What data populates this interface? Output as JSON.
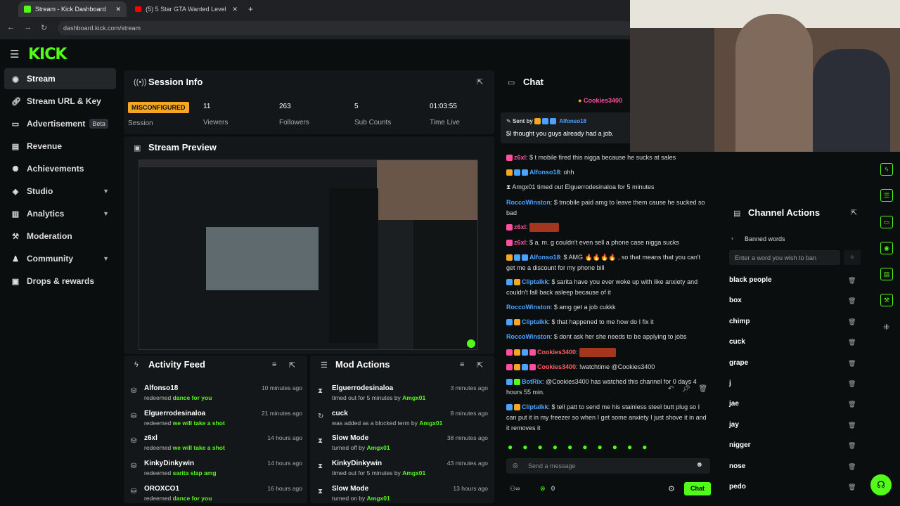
{
  "browser": {
    "tabs": [
      {
        "label": "Stream - Kick Dashboard"
      },
      {
        "label": "(5) 5 Star GTA Wanted Level in I"
      }
    ],
    "address": "dashboard.kick.com/stream"
  },
  "brand": {
    "logo": "KICK",
    "accent": "#53fc18"
  },
  "sidebar": {
    "items": [
      {
        "label": "Stream"
      },
      {
        "label": "Stream URL & Key"
      },
      {
        "label": "Advertisement",
        "badge": "Beta"
      },
      {
        "label": "Revenue"
      },
      {
        "label": "Achievements"
      },
      {
        "label": "Studio"
      },
      {
        "label": "Analytics"
      },
      {
        "label": "Moderation"
      },
      {
        "label": "Community"
      },
      {
        "label": "Drops & rewards"
      }
    ]
  },
  "session": {
    "title": "Session Info",
    "status": "MISCONFIGURED",
    "status_label": "Session",
    "viewers": "11",
    "viewers_label": "Viewers",
    "followers": "263",
    "followers_label": "Followers",
    "subs": "5",
    "subs_label": "Sub Counts",
    "time": "01:03:55",
    "time_label": "Time Live"
  },
  "preview": {
    "title": "Stream Preview"
  },
  "activity": {
    "title": "Activity Feed",
    "rows": [
      {
        "name": "Alfonso18",
        "prefix": "redeemed",
        "reward": "dance for you",
        "ago": "10 minutes ago"
      },
      {
        "name": "Elguerrodesinaloa",
        "prefix": "redeemed",
        "reward": "we will take a shot",
        "ago": "21 minutes ago"
      },
      {
        "name": "z6xl",
        "prefix": "redeemed",
        "reward": "we will take a shot",
        "ago": "14 hours ago"
      },
      {
        "name": "KinkyDinkywin",
        "prefix": "redeemed",
        "reward": "sarita slap amg",
        "ago": "14 hours ago"
      },
      {
        "name": "OROXCO1",
        "prefix": "redeemed",
        "reward": "dance for you",
        "ago": "16 hours ago"
      }
    ]
  },
  "modactions": {
    "title": "Mod Actions",
    "rows": [
      {
        "name": "Elguerrodesinaloa",
        "action": "timed out for 5 minutes by",
        "by": "Amgx01",
        "ago": "3 minutes ago"
      },
      {
        "name": "cuck",
        "action": "was added as a blocked term by",
        "by": "Amgx01",
        "ago": "8 minutes ago"
      },
      {
        "name": "Slow Mode",
        "action": "turned off by",
        "by": "Amgx01",
        "ago": "38 minutes ago"
      },
      {
        "name": "KinkyDinkywin",
        "action": "timed out for 5 minutes by",
        "by": "Amgx01",
        "ago": "43 minutes ago"
      },
      {
        "name": "Slow Mode",
        "action": "turned on by",
        "by": "Amgx01",
        "ago": "13 hours ago"
      }
    ]
  },
  "chat": {
    "title": "Chat",
    "pinned_user": "Cookies3400",
    "sent_by_label": "Sent by",
    "sent_by_user": "Alfonso18",
    "pinned_text": "$I thought you guys already had a job.",
    "messages": [
      {
        "user": "z6xl",
        "text": ": $ t mobile fired this nigga because he sucks at sales"
      },
      {
        "user": "Alfonso18",
        "text": ": ohh"
      },
      {
        "user": "Amgx01",
        "text": " timed out Elguerrodesinaloa for 5 minutes"
      },
      {
        "user": "RoccoWinston",
        "text": ": $ tmobile paid amg to leave them cause he sucked so bad"
      },
      {
        "user": "z6xl",
        "text": ":"
      },
      {
        "user": "z6xl",
        "text": ": $ a. m. g couldn't even sell a phone case nigga sucks"
      },
      {
        "user": "Alfonso18",
        "text": ": $ AMG 🔥🔥🔥🔥 , so that means that you can't get me a discount for my phone bill"
      },
      {
        "user": "Cliptalkk",
        "text": ": $ sarita have you ever woke up with like anxiety and couldn't fall back asleep because of it"
      },
      {
        "user": "RoccoWinston",
        "text": ": $ amg get a job cukkk"
      },
      {
        "user": "Cliptalkk",
        "text": ": $ that happened to me how do I fix it"
      },
      {
        "user": "RoccoWinston",
        "text": ": $ dont ask her she needs to be applying to jobs"
      },
      {
        "user": "Cookies3400",
        "text": ":"
      },
      {
        "user": "Cookies3400",
        "text": ": !watchtime @Cookies3400"
      },
      {
        "user": "BotRix",
        "text": ": @Cookies3400 has watched this channel for 0 days 4 hours 55 min."
      },
      {
        "user": "Cliptalkk",
        "text": ": $ tell patt to send me his stainless steel butt plug so I can put it in my freezer so when I get some anxiety I just shove it in and it removes it"
      }
    ],
    "input_placeholder": "Send a message",
    "count": "0",
    "send_label": "Chat"
  },
  "channel_actions": {
    "title": "Channel Actions",
    "subtitle": "Banned words",
    "input_placeholder": "Enter a word you wish to ban",
    "words": [
      "black people",
      "box",
      "chimp",
      "cuck",
      "grape",
      "j",
      "jae",
      "jay",
      "nigger",
      "nose",
      "pedo"
    ]
  }
}
